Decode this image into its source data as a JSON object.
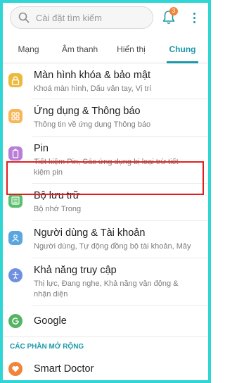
{
  "search": {
    "placeholder": "Cài đặt tìm kiếm"
  },
  "notifications": {
    "badge_count": "3"
  },
  "tabs": [
    {
      "label": "Mạng"
    },
    {
      "label": "Âm thanh"
    },
    {
      "label": "Hiển thị"
    },
    {
      "label": "Chung"
    }
  ],
  "items": [
    {
      "title": "Màn hình khóa & bảo mật",
      "subtitle": "Khoá màn hình, Dấu vân tay, Vị trí",
      "icon": "lock-icon",
      "color": "#eaba3f"
    },
    {
      "title": "Ứng dụng & Thông báo",
      "subtitle": "Thông tin về ứng dụng Thông báo",
      "icon": "apps-icon",
      "color": "#f6b75a"
    },
    {
      "title": "Pin",
      "subtitle": "Tiết kiệm Pin, Các ứng dụng bị loại trừ tiết kiệm pin",
      "icon": "battery-icon",
      "color": "#b97fd8"
    },
    {
      "title": "Bộ lưu trữ",
      "subtitle": "Bộ nhớ Trong",
      "icon": "storage-icon",
      "color": "#58c06a"
    },
    {
      "title": "Người dùng & Tài khoản",
      "subtitle": "Người dùng, Tự động đồng bộ tài khoản, Mây",
      "icon": "user-icon",
      "color": "#5aa6de"
    },
    {
      "title": "Khả năng truy cập",
      "subtitle": "Thị lực, Đang nghe, Khả năng vận động & nhận diện",
      "icon": "accessibility-icon",
      "color": "#6f8fe0"
    },
    {
      "title": "Google",
      "subtitle": "",
      "icon": "google-icon",
      "color": "#55b463"
    }
  ],
  "section": {
    "label": "CÁC PHẦN MỞ RỘNG"
  },
  "extension_item": {
    "title": "Smart Doctor",
    "icon": "smart-doctor-icon",
    "color": "#f0843a"
  },
  "accent": "#1b98a8",
  "highlight_color": "#e02020"
}
